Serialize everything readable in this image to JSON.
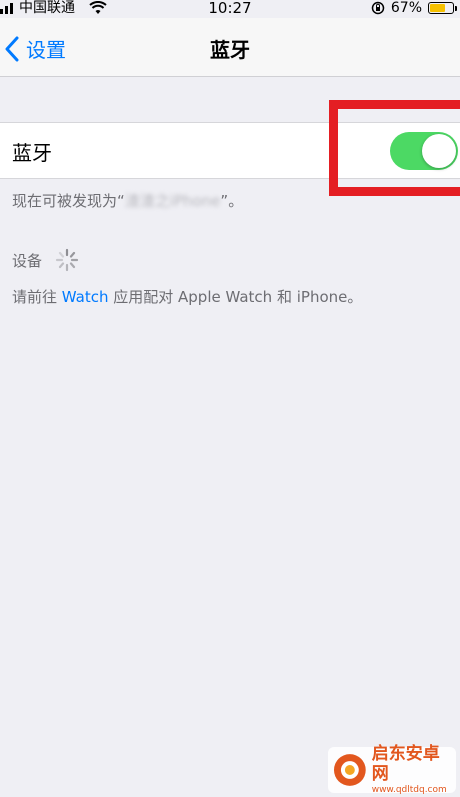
{
  "status_bar": {
    "carrier": "中国联通",
    "time": "10:27",
    "battery_percent": "67%",
    "battery_level": 0.67,
    "battery_color": "#f5c000"
  },
  "nav": {
    "back_label": "设置",
    "title": "蓝牙"
  },
  "bluetooth": {
    "label": "蓝牙",
    "enabled": true,
    "toggle_color": "#4cd964"
  },
  "discoverable": {
    "prefix": "现在可被发现为“",
    "name": "渣渣之iPhone",
    "suffix": "”。"
  },
  "devices": {
    "header": "设备",
    "loading_icon": "spinner-icon"
  },
  "watch_note": {
    "prefix": "请前往 ",
    "link": "Watch",
    "suffix": " 应用配对 Apple Watch 和 iPhone。"
  },
  "watermark": {
    "name": "启东安卓网",
    "url": "www.qdltdq.com"
  },
  "accent_color": "#007aff",
  "highlight_color": "#e41e23"
}
